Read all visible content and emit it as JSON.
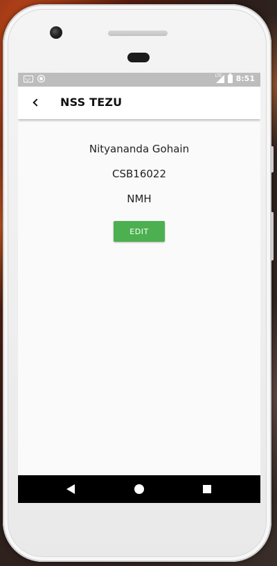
{
  "status_bar": {
    "time": "8:51",
    "network": "LTE",
    "icons": [
      "gmail-icon",
      "notification-dot-icon",
      "signal-icon",
      "battery-icon"
    ]
  },
  "app_bar": {
    "title": "NSS TEZU",
    "back_icon": "chevron-left-icon"
  },
  "profile": {
    "name": "Nityananda Gohain",
    "roll_number": "CSB16022",
    "hostel": "NMH"
  },
  "actions": {
    "edit_label": "EDIT"
  },
  "nav_bar": {
    "icons": [
      "nav-back-icon",
      "nav-home-icon",
      "nav-recents-icon"
    ]
  },
  "colors": {
    "accent": "#4caf50",
    "status_bar": "#bdbdbd",
    "app_bar": "#ffffff",
    "nav_bar": "#000000",
    "screen_background": "#fafafa"
  }
}
